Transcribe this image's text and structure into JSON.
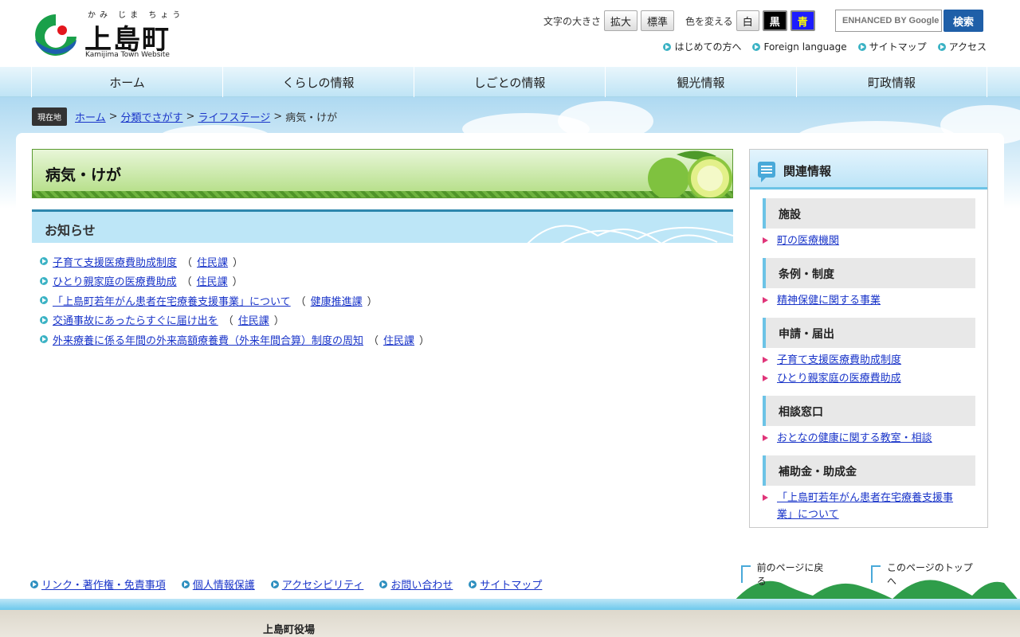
{
  "header": {
    "logo_ruby": "かみ じま ちょう",
    "logo_name": "上島町",
    "logo_en": "Kamijima Town Website",
    "font_size_label": "文字の大きさ",
    "font_enlarge": "拡大",
    "font_standard": "標準",
    "color_label": "色を変える",
    "color_white": "白",
    "color_black": "黒",
    "color_blue": "青",
    "search_placeholder": "ENHANCED BY Google",
    "search_button": "検索",
    "sublinks": [
      "はじめての方へ",
      "Foreign language",
      "サイトマップ",
      "アクセス"
    ]
  },
  "nav": [
    "ホーム",
    "くらしの情報",
    "しごとの情報",
    "観光情報",
    "町政情報"
  ],
  "breadcrumb": {
    "here_label": "現在地",
    "items": [
      "ホーム",
      "分類でさがす",
      "ライフステージ"
    ],
    "current": "病気・けが"
  },
  "main": {
    "title": "病気・けが",
    "news_heading": "お知らせ",
    "news": [
      {
        "title": "子育て支援医療費助成制度",
        "dept": "住民課"
      },
      {
        "title": "ひとり親家庭の医療費助成",
        "dept": "住民課"
      },
      {
        "title": "「上島町若年がん患者在宅療養支援事業」について",
        "dept": "健康推進課"
      },
      {
        "title": "交通事故にあったらすぐに届け出を",
        "dept": "住民課"
      },
      {
        "title": "外来療養に係る年間の外来高額療養費（外来年間合算）制度の周知",
        "dept": "住民課"
      }
    ]
  },
  "side": {
    "heading": "関連情報",
    "categories": [
      {
        "name": "施設",
        "items": [
          "町の医療機関"
        ]
      },
      {
        "name": "条例・制度",
        "items": [
          "精神保健に関する事業"
        ]
      },
      {
        "name": "申請・届出",
        "items": [
          "子育て支援医療費助成制度",
          "ひとり親家庭の医療費助成"
        ]
      },
      {
        "name": "相談窓口",
        "items": [
          "おとなの健康に関する教室・相談"
        ]
      },
      {
        "name": "補助金・助成金",
        "items": [
          "「上島町若年がん患者在宅療養支援事業」について"
        ]
      }
    ]
  },
  "footer": {
    "links": [
      "リンク・著作権・免責事項",
      "個人情報保護",
      "アクセシビリティ",
      "お問い合わせ",
      "サイトマップ"
    ],
    "back": "前のページに戻る",
    "top": "このページのトップへ",
    "townhall": "上島町役場"
  }
}
